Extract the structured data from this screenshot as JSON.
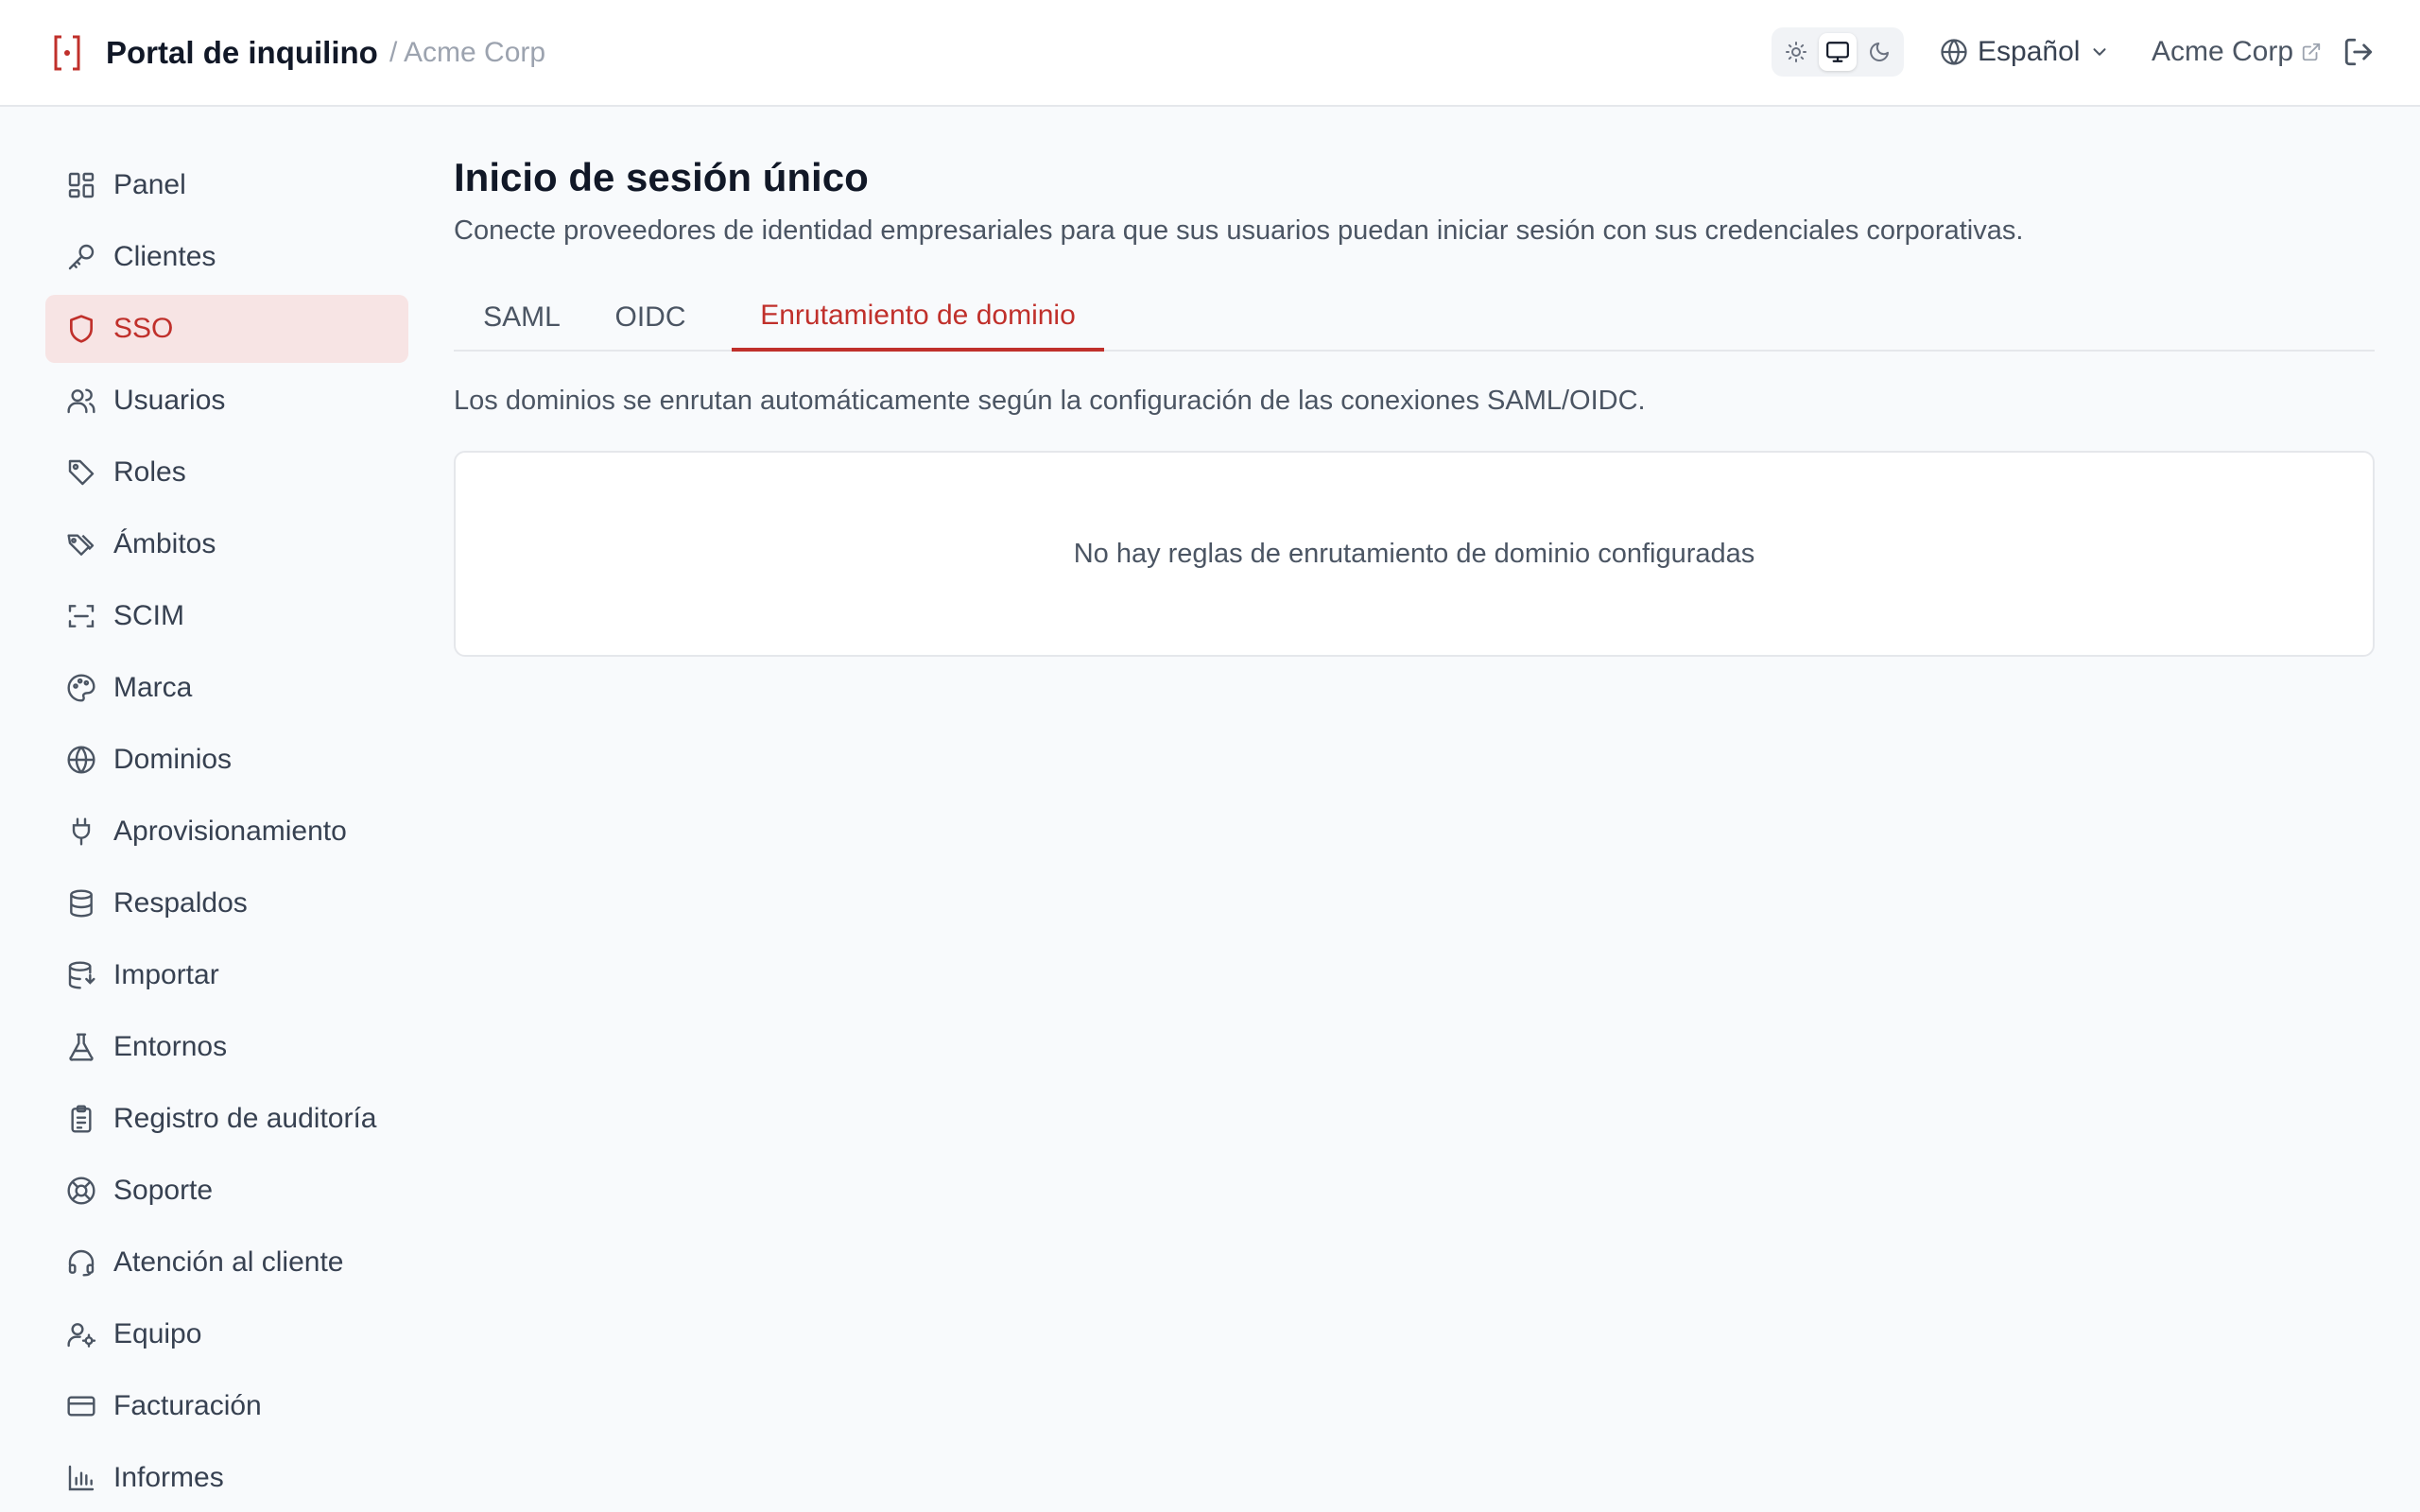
{
  "header": {
    "app_title": "Portal de inquilino",
    "tenant_crumb": "/ Acme Corp",
    "language": "Español",
    "org_link": "Acme Corp",
    "theme_options": [
      "light",
      "system",
      "dark"
    ],
    "theme_selected": "system"
  },
  "sidebar": {
    "items": [
      {
        "label": "Panel",
        "icon": "dashboard-icon"
      },
      {
        "label": "Clientes",
        "icon": "key-icon"
      },
      {
        "label": "SSO",
        "icon": "shield-icon",
        "active": true
      },
      {
        "label": "Usuarios",
        "icon": "users-icon"
      },
      {
        "label": "Roles",
        "icon": "tag-icon"
      },
      {
        "label": "Ámbitos",
        "icon": "tags-icon"
      },
      {
        "label": "SCIM",
        "icon": "scan-icon"
      },
      {
        "label": "Marca",
        "icon": "palette-icon"
      },
      {
        "label": "Dominios",
        "icon": "globe-icon"
      },
      {
        "label": "Aprovisionamiento",
        "icon": "plug-icon"
      },
      {
        "label": "Respaldos",
        "icon": "database-icon"
      },
      {
        "label": "Importar",
        "icon": "database-import-icon"
      },
      {
        "label": "Entornos",
        "icon": "flask-icon"
      },
      {
        "label": "Registro de auditoría",
        "icon": "clipboard-icon"
      },
      {
        "label": "Soporte",
        "icon": "lifebuoy-icon"
      },
      {
        "label": "Atención al cliente",
        "icon": "headset-icon"
      },
      {
        "label": "Equipo",
        "icon": "user-cog-icon"
      },
      {
        "label": "Facturación",
        "icon": "credit-card-icon"
      },
      {
        "label": "Informes",
        "icon": "bar-chart-icon"
      }
    ]
  },
  "main": {
    "title": "Inicio de sesión único",
    "subtitle": "Conecte proveedores de identidad empresariales para que sus usuarios puedan iniciar sesión con sus credenciales corporativas.",
    "tabs": [
      {
        "label": "SAML"
      },
      {
        "label": "OIDC"
      },
      {
        "label": "Enrutamiento de dominio",
        "active": true
      }
    ],
    "routing_info": "Los dominios se enrutan automáticamente según la configuración de las conexiones SAML/OIDC.",
    "empty_state": "No hay reglas de enrutamiento de dominio configuradas"
  },
  "colors": {
    "accent": "#c0302b",
    "active_bg": "#f7e4e4",
    "page_bg": "#f8fafc"
  }
}
